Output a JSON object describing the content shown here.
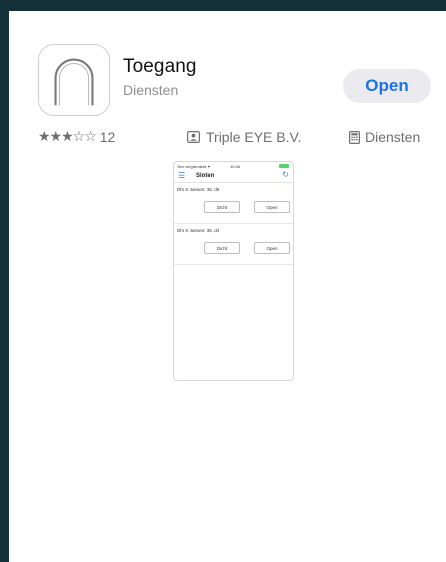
{
  "app": {
    "title": "Toegang",
    "subtitle": "Diensten",
    "open_label": "Open",
    "icon": "app-logo-icon"
  },
  "info": {
    "stars": "★★★☆☆",
    "rating_value": 3,
    "rating_count": "12",
    "developer": "Triple EYE B.V.",
    "developer_icon": "person-badge-icon",
    "category": "Diensten",
    "category_icon": "calculator-icon"
  },
  "preview": {
    "carrier": "Sim vergrendeld ✦",
    "time": "10:46",
    "nav_title": "Sloten",
    "items": [
      {
        "address": "Dhr K Jansen: 35, d5",
        "close_label": "Dicht",
        "open_label": "Open"
      },
      {
        "address": "Dhr K Jansen: 35, d4",
        "close_label": "Dicht",
        "open_label": "Open"
      }
    ]
  },
  "colors": {
    "frame": "#143038",
    "accent": "#1a73e8",
    "button_bg": "#eaeaef",
    "secondary_text": "#8e8e93"
  }
}
